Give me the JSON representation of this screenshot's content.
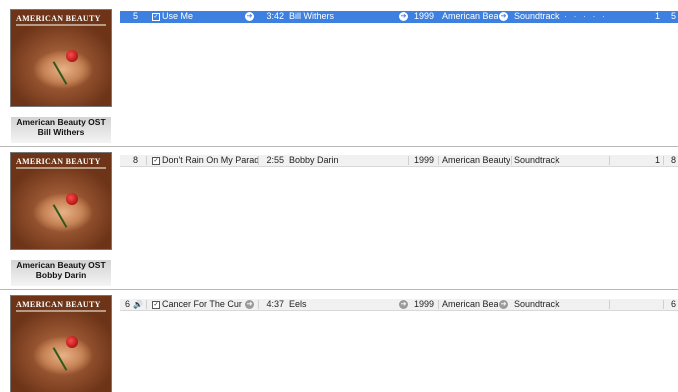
{
  "groups": [
    {
      "caption": {
        "album": "American Beauty OST",
        "artist": "Bill Withers"
      },
      "art_title": "AMERICAN BEAUTY",
      "track": {
        "number": "5",
        "name": "Use Me",
        "time": "3:42",
        "artist": "Bill Withers",
        "year": "1999",
        "album": "American Bea...",
        "genre": "Soundtrack",
        "rating": "· · · · ·",
        "plays": "1",
        "extra": "5",
        "selected": true,
        "playing": false
      }
    },
    {
      "caption": {
        "album": "American Beauty OST",
        "artist": "Bobby Darin"
      },
      "art_title": "AMERICAN BEAUTY",
      "track": {
        "number": "8",
        "name": "Don't Rain On My Parade",
        "time": "2:55",
        "artist": "Bobby Darin",
        "year": "1999",
        "album": "American Beauty...",
        "genre": "Soundtrack",
        "rating": "",
        "plays": "1",
        "extra": "8",
        "selected": false,
        "playing": false
      }
    },
    {
      "caption": {
        "album": "",
        "artist": ""
      },
      "art_title": "AMERICAN BEAUTY",
      "track": {
        "number": "6",
        "name": "Cancer For The Cure",
        "time": "4:37",
        "artist": "Eels",
        "year": "1999",
        "album": "American Bea...",
        "genre": "Soundtrack",
        "rating": "",
        "plays": "",
        "extra": "6",
        "selected": false,
        "playing": true
      }
    }
  ],
  "icons": {
    "checkbox": "check-mark",
    "go_arrow": "circle-arrow-right",
    "speaker": "speaker-icon"
  }
}
